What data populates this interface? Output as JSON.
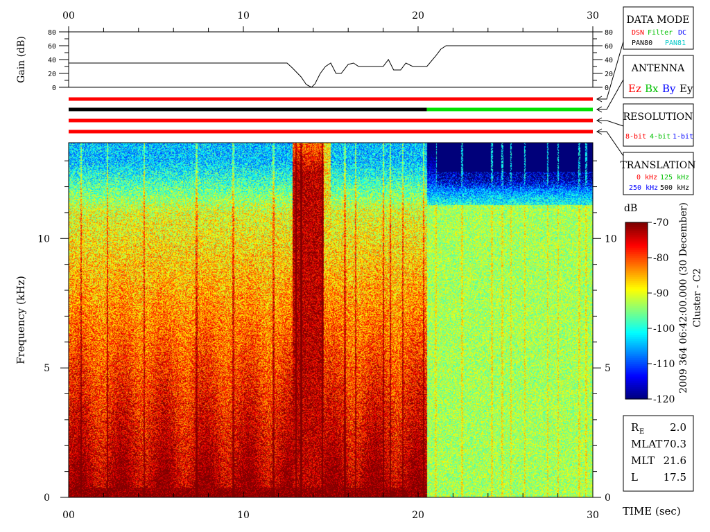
{
  "chart_data": [
    {
      "type": "line",
      "name_key": "gain",
      "ylabel": "Gain (dB)",
      "ylim": [
        0,
        80
      ],
      "y_ticks": [
        "0",
        "20",
        "40",
        "60",
        "80"
      ],
      "xlim": [
        0,
        30
      ],
      "x_ticks": [
        "00",
        "10",
        "20",
        "30"
      ],
      "x": [
        0,
        12.5,
        12.8,
        13.3,
        13.6,
        13.9,
        14.1,
        14.4,
        14.7,
        15.0,
        15.3,
        15.6,
        16.0,
        16.3,
        16.6,
        17.0,
        18.0,
        18.3,
        18.6,
        19.0,
        19.3,
        19.7,
        20.0,
        20.5,
        21.0,
        21.3,
        21.6,
        30
      ],
      "y": [
        35,
        35,
        28,
        15,
        4,
        0,
        5,
        20,
        30,
        35,
        20,
        20,
        33,
        35,
        30,
        30,
        30,
        40,
        25,
        25,
        35,
        30,
        30,
        30,
        45,
        55,
        60,
        60
      ]
    },
    {
      "type": "heatmap",
      "name_key": "spectrogram",
      "title": "",
      "xlabel": "TIME (sec)",
      "ylabel": "Frequency (kHz)",
      "xlim": [
        0,
        30
      ],
      "ylim": [
        0,
        13.7
      ],
      "x_ticks": [
        "00",
        "10",
        "20",
        "30"
      ],
      "y_ticks": [
        "0",
        "5",
        "10"
      ],
      "colorbar": {
        "label": "dB",
        "range": [
          -120,
          -70
        ],
        "ticks": [
          "-70",
          "-80",
          "-90",
          "-100",
          "-110",
          "-120"
        ]
      },
      "side_label": "2009 364 06:42:00.000 (30 December)",
      "spacecraft": "Cluster - C2",
      "regions": [
        {
          "t0": 0,
          "t1": 20.5,
          "note": "strong broadband emission, -70 dB at low frequencies, ~ -100 dB above 12 kHz"
        },
        {
          "t0": 20.5,
          "t1": 30,
          "note": "uniform ~ -90 dB below 11.5 kHz, below -120 dB above 12 kHz"
        }
      ]
    }
  ],
  "mode_bars": [
    {
      "color": "#ff0000",
      "segments": [
        [
          0,
          30,
          "#ff0000"
        ]
      ]
    },
    {
      "color": "#000000",
      "segments": [
        [
          0,
          20.5,
          "#000000"
        ],
        [
          20.5,
          30,
          "#00e000"
        ]
      ]
    },
    {
      "color": "#ff0000",
      "segments": [
        [
          0,
          30,
          "#ff0000"
        ]
      ]
    },
    {
      "color": "#ff0000",
      "segments": [
        [
          0,
          30,
          "#ff0000"
        ]
      ]
    }
  ],
  "legend": {
    "data_mode": {
      "title": "DATA MODE",
      "row1": [
        {
          "text": "DSN",
          "color": "#ff0000"
        },
        {
          "text": "Filter",
          "color": "#00c000"
        },
        {
          "text": "DC",
          "color": "#0000ff"
        }
      ],
      "row2": [
        {
          "text": "PAN80",
          "color": "#000000"
        },
        {
          "text": "PAN81",
          "color": "#00c8c8"
        }
      ]
    },
    "antenna": {
      "title": "ANTENNA",
      "items": [
        {
          "text": "Ez",
          "color": "#ff0000"
        },
        {
          "text": "Bx",
          "color": "#00c000"
        },
        {
          "text": "By",
          "color": "#0000ff"
        },
        {
          "text": "Ey",
          "color": "#000000"
        }
      ]
    },
    "resolution": {
      "title": "RESOLUTION",
      "items": [
        {
          "text": "8-bit",
          "color": "#ff0000"
        },
        {
          "text": "4-bit",
          "color": "#00c000"
        },
        {
          "text": "1-bit",
          "color": "#0000ff"
        }
      ]
    },
    "translation": {
      "title": "TRANSLATION",
      "row1": [
        {
          "text": "0 kHz",
          "color": "#ff0000"
        },
        {
          "text": "125 kHz",
          "color": "#00c000"
        }
      ],
      "row2": [
        {
          "text": "250 kHz",
          "color": "#0000ff"
        },
        {
          "text": "500 kHz",
          "color": "#000000"
        }
      ]
    }
  },
  "orbit": {
    "rows": [
      {
        "label": "R",
        "sub": "E",
        "value": "2.0"
      },
      {
        "label": "MLAT",
        "sub": "",
        "value": "70.3"
      },
      {
        "label": "MLT",
        "sub": "",
        "value": "21.6"
      },
      {
        "label": "L",
        "sub": "",
        "value": "17.5"
      }
    ]
  },
  "colors": {
    "axis": "#000000",
    "nodata": "#00007a"
  }
}
